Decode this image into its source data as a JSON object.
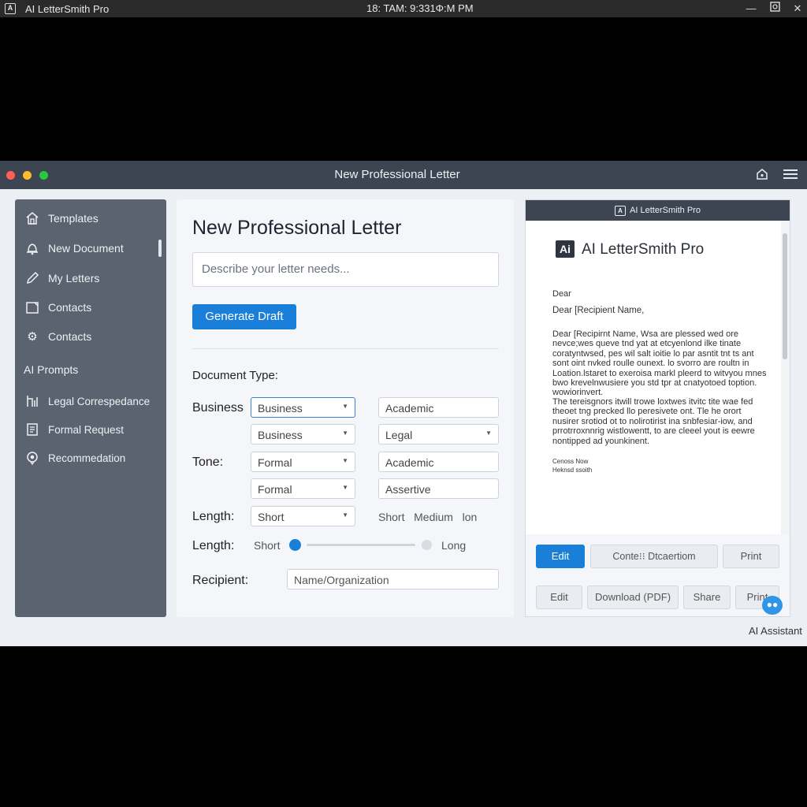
{
  "os": {
    "title": "AI LetterSmith Pro",
    "clock": "18: TAM: 9:331Φ:M PM",
    "logo_icon": "app-logo-icon",
    "controls": [
      "minimize-icon",
      "restore-icon",
      "close-icon"
    ]
  },
  "window": {
    "title": "New Professional Letter",
    "traffic_colors": [
      "#ff5f57",
      "#febc2e",
      "#28c840"
    ]
  },
  "sidebar": {
    "items": [
      {
        "label": "Templates",
        "icon": "home-icon"
      },
      {
        "label": "New Document",
        "icon": "bell-icon"
      },
      {
        "label": "My Letters",
        "icon": "pencil-icon"
      },
      {
        "label": "Contacts",
        "icon": "square-icon"
      },
      {
        "label": "Contacts",
        "icon": "gear-icon"
      }
    ],
    "heading": "AI Prompts",
    "prompts": [
      {
        "label": "Legal Correspedance",
        "icon": "legal-icon"
      },
      {
        "label": "Formal Request",
        "icon": "document-icon"
      },
      {
        "label": "Recommedation",
        "icon": "badge-icon"
      }
    ]
  },
  "main": {
    "title": "New Professional Letter",
    "needs_placeholder": "Describe your letter needs...",
    "generate_label": "Generate Draft",
    "doc_type_label": "Document Type:",
    "business_label": "Business",
    "tone_label": "Tone:",
    "length_label": "Length:",
    "length_label2": "Length:",
    "recipient_label": "Recipient:",
    "dropdowns": {
      "d1": "Business",
      "d2": "Academic",
      "d3": "Business",
      "d4": "Legal",
      "d5": "Formal",
      "d6": "Academic",
      "d7": "Formal",
      "d8": "Assertive",
      "d9": "Short"
    },
    "length_options": "Short   Medium   lon",
    "slider_min": "Short",
    "slider_max": "Long",
    "slider_value": 0,
    "recipient_placeholder": "Name/Organization"
  },
  "preview": {
    "header": "AI LetterSmith Pro",
    "brand": "AI LetterSmith Pro",
    "logo_text": "Ai",
    "line_dear": "Dear",
    "line_recipient": "Dear [Recipient Name,",
    "para1": "Dear [Recipirnt Name, Wsa are plessed  wed ore\nnevce;wes queve tnd yat at etcyenlond ilke tinate\ncoratyntwsed, pes wil salt ioitie lo par asntit tnt ts ant\nsont oint nvked roulle ounext. lo svorro are roultn in\nLoation.lstaret to exeroisa markl pleerd to witvyou mnes\nbwo krevelnwusiere you std tpr at cnatyotoed toption.\nwowiorinvert.",
    "para2": "The tereisgnors itwill trowe loxtwes itvitc tite wae fed\ntheoet tng precked llo peresivete ont. Tle he orort\nnusirer srotiod ot to nolirotirist ina snbfesiar-iow, and\nprrotrroxnnrig wistlowentt, to are cleeel yout is eewre\nnontipped ad younkinent.",
    "sig1": "Cenoss Now",
    "sig2": "Heknsd ssoith",
    "buttons_row1": [
      "Edit",
      "Conte⁝⁝ Dtcaertiom",
      "Print"
    ],
    "buttons_row2": [
      "Edit",
      "Download (PDF)",
      "Share",
      "Print"
    ]
  },
  "assistant": {
    "label": "AI Assistant",
    "icon": "chat-bubble-icon"
  }
}
